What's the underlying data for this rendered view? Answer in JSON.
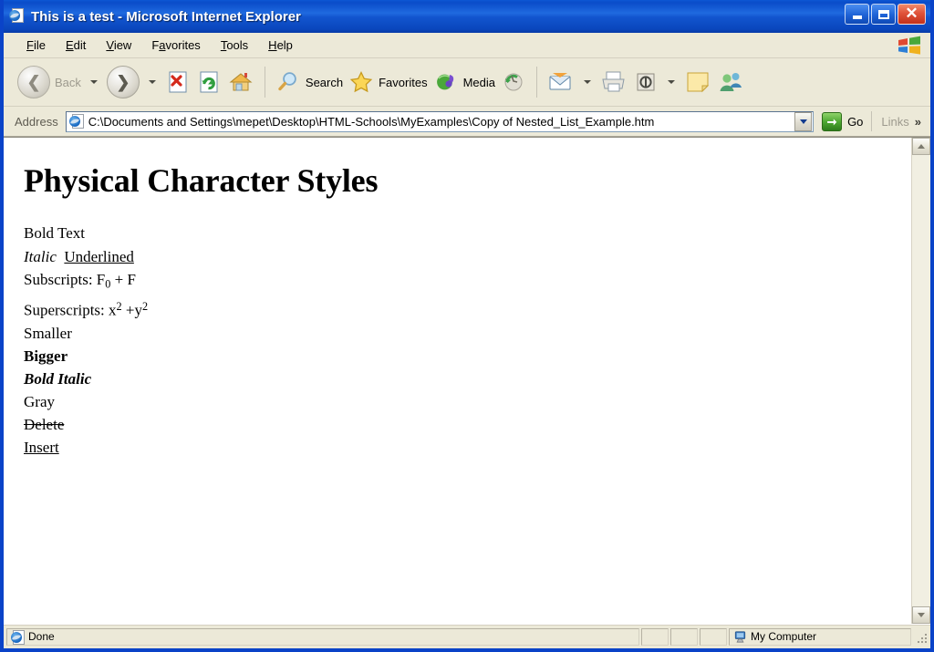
{
  "window": {
    "title": "This is a test - Microsoft Internet Explorer",
    "title_icon": "ie-document-icon",
    "minimize_label": "",
    "maximize_label": "",
    "close_label": "✕",
    "accent_blue": "#0a43c8",
    "chrome_bg": "#ece9d8"
  },
  "menu": {
    "items": [
      {
        "label": "File",
        "accel": "F"
      },
      {
        "label": "Edit",
        "accel": "E"
      },
      {
        "label": "View",
        "accel": "V"
      },
      {
        "label": "Favorites",
        "accel": "a"
      },
      {
        "label": "Tools",
        "accel": "T"
      },
      {
        "label": "Help",
        "accel": "H"
      }
    ],
    "brand_icon": "windows-flag-icon"
  },
  "toolbar": {
    "back_label": "Back",
    "back_icon": "back-arrow-icon",
    "back_disabled": true,
    "forward_icon": "forward-arrow-icon",
    "stop_icon": "stop-icon",
    "refresh_icon": "refresh-icon",
    "home_icon": "home-icon",
    "search_label": "Search",
    "search_icon": "search-magnifier-icon",
    "favorites_label": "Favorites",
    "favorites_icon": "favorites-star-icon",
    "media_label": "Media",
    "media_icon": "media-globe-icon",
    "history_icon": "history-icon",
    "mail_icon": "mail-icon",
    "print_icon": "print-icon",
    "edit_icon": "edit-page-icon",
    "notes_icon": "notes-icon",
    "messenger_icon": "messenger-icon"
  },
  "address": {
    "label": "Address",
    "value": "C:\\Documents and Settings\\mepet\\Desktop\\HTML-Schools\\MyExamples\\Copy of Nested_List_Example.htm",
    "placeholder": "",
    "favicon": "ie-document-icon",
    "dropdown_icon": "chevron-down-icon",
    "go_label": "Go",
    "go_icon": "go-arrow-icon",
    "links_label": "Links",
    "overflow_icon": "»"
  },
  "content": {
    "heading": "Physical Character Styles",
    "lines": {
      "bold_text": "Bold Text",
      "italic": "Italic",
      "underlined": "Underlined",
      "subscripts_label": "Subscripts: F",
      "subscripts_sub": "0",
      "subscripts_tail": " + F",
      "superscripts_label": "Superscripts: x",
      "superscripts_sup1": "2",
      "superscripts_mid": " +y",
      "superscripts_sup2": "2",
      "smaller": "Smaller",
      "bigger": "Bigger",
      "bold_italic": "Bold Italic",
      "gray": "Gray",
      "delete": "Delete",
      "insert": "Insert"
    },
    "gray_color": "#666666"
  },
  "scrollbar": {
    "up_icon": "chevron-up-icon",
    "down_icon": "chevron-down-icon"
  },
  "statusbar": {
    "status_text": "Done",
    "status_icon": "ie-document-icon",
    "zone_text": "My Computer",
    "zone_icon": "my-computer-icon"
  }
}
